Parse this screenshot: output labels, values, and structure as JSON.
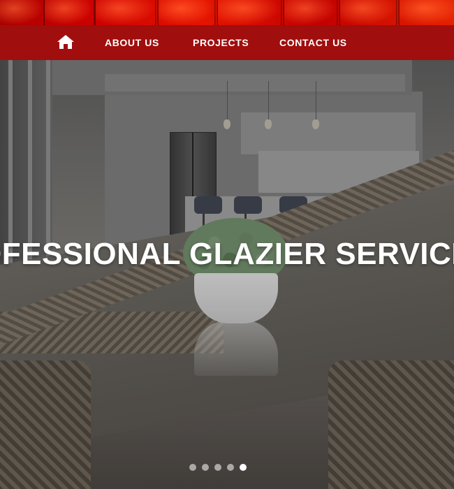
{
  "nav": {
    "home_icon": "home-icon",
    "links": [
      {
        "label": "ABOUT US"
      },
      {
        "label": "PROJECTS"
      },
      {
        "label": "CONTACT US"
      }
    ]
  },
  "hero": {
    "title": "OFESSIONAL GLAZIER SERVICE",
    "slides_total": 5,
    "active_slide": 5
  },
  "colors": {
    "nav_background": "#a00e0e",
    "top_strip": "#e10000",
    "text": "#ffffff"
  }
}
